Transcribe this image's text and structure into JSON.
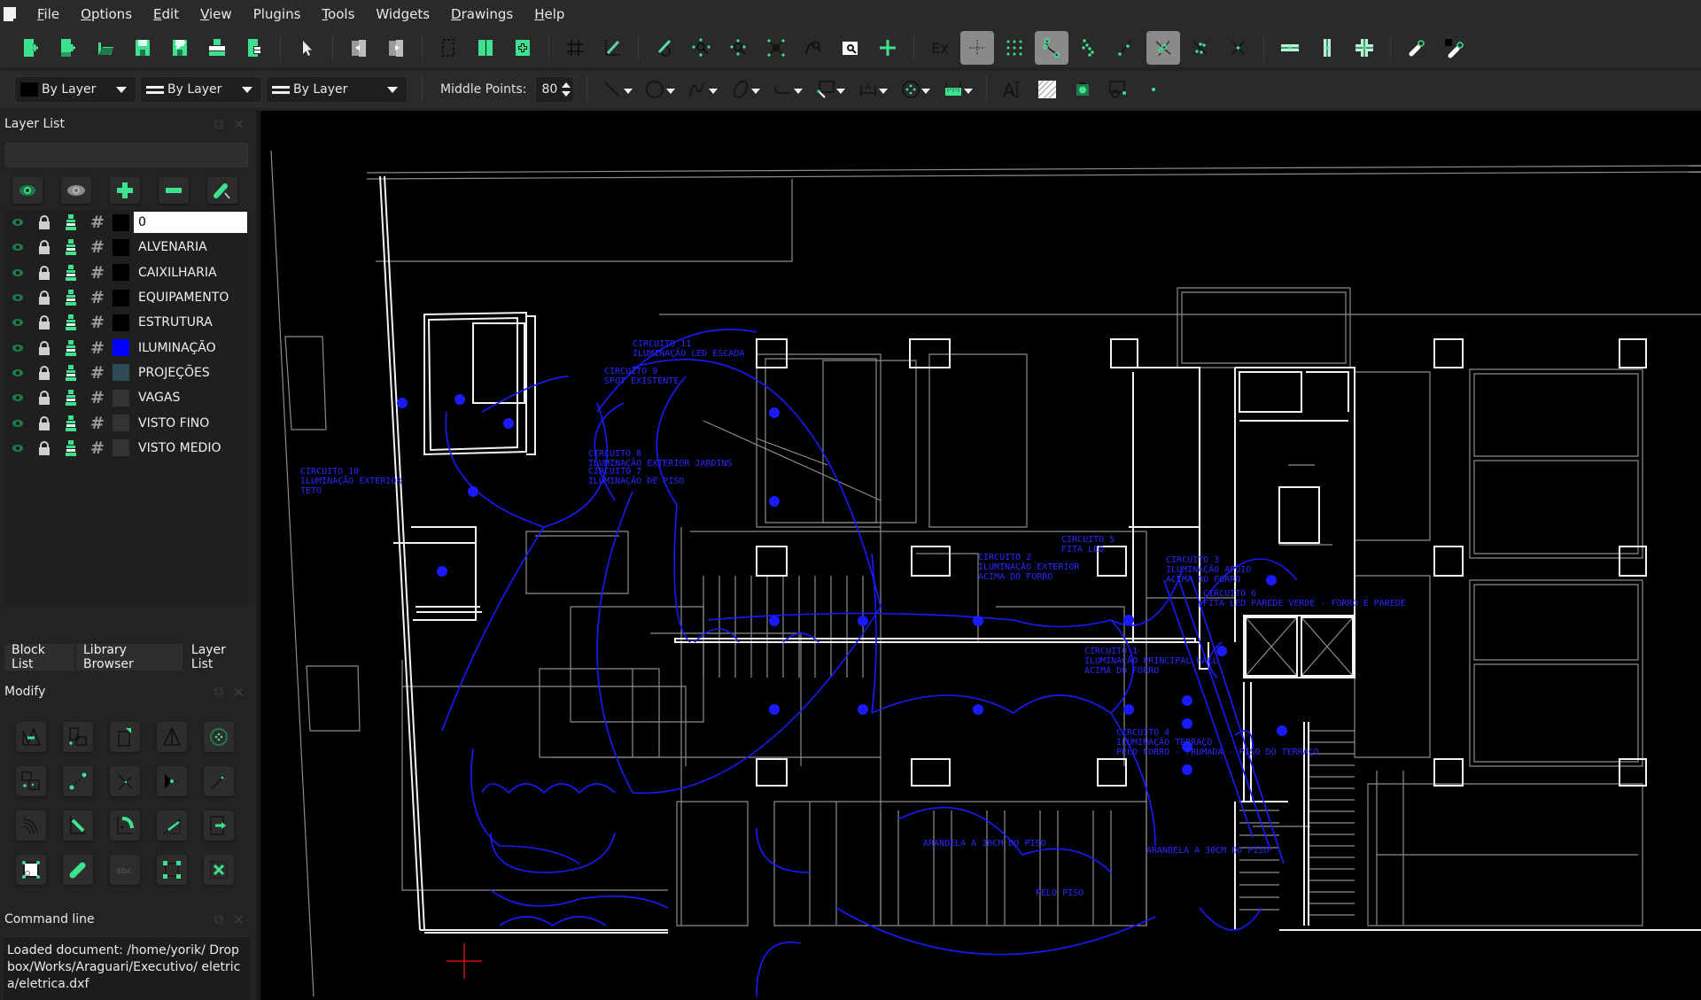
{
  "menubar": {
    "items": [
      {
        "label": "File",
        "ul": "F",
        "rest": "ile"
      },
      {
        "label": "Options",
        "ul": "O",
        "rest": "ptions"
      },
      {
        "label": "Edit",
        "ul": "E",
        "rest": "dit"
      },
      {
        "label": "View",
        "ul": "V",
        "rest": "iew"
      },
      {
        "label": "Plugins",
        "ul": "",
        "rest": "Plugins"
      },
      {
        "label": "Tools",
        "ul": "T",
        "rest": "ools"
      },
      {
        "label": "Widgets",
        "ul": "",
        "rest": "Widgets"
      },
      {
        "label": "Drawings",
        "ul": "D",
        "rest": "rawings"
      },
      {
        "label": "Help",
        "ul": "H",
        "rest": "elp"
      }
    ]
  },
  "toolbar1": {
    "file_tools": [
      "new-file",
      "new-from-template",
      "open-file",
      "save",
      "save-as",
      "print",
      "print-preview"
    ],
    "select_tool": "select-pointer",
    "block_tools": [
      "previous-view",
      "next-view",
      "window-select",
      "add-block",
      "insert-block"
    ],
    "snap_grid_label": "Ex",
    "snap_tools": [
      {
        "name": "snap-free",
        "active": true
      },
      {
        "name": "snap-grid",
        "active": false
      },
      {
        "name": "snap-endpoint",
        "active": true
      },
      {
        "name": "snap-on-entity",
        "active": false
      },
      {
        "name": "snap-center",
        "active": false
      },
      {
        "name": "snap-intersection",
        "active": true
      },
      {
        "name": "snap-middle",
        "active": false
      },
      {
        "name": "snap-distance",
        "active": false
      }
    ],
    "restrict_tools": [
      "restrict-horizontal",
      "restrict-vertical",
      "restrict-orthogonal"
    ],
    "relative_zero_tools": [
      "set-relative-zero",
      "lock-relative-zero"
    ]
  },
  "toolbar2": {
    "color_combo": "By Layer",
    "width_combo": "By Layer",
    "linetype_combo": "By Layer",
    "middle_points_label": "Middle Points:",
    "middle_points_value": "80",
    "draw_tools": [
      "line",
      "circle",
      "spline",
      "ellipse",
      "polyline",
      "select",
      "dimension",
      "modify",
      "info"
    ],
    "extra_tools": [
      "text",
      "hatch",
      "image",
      "block",
      "point"
    ]
  },
  "layer_panel": {
    "title": "Layer List",
    "filter_placeholder": "",
    "buttons": [
      "show-all-layers",
      "hide-all-layers",
      "add-layer",
      "remove-layer",
      "edit-layer"
    ],
    "layers": [
      {
        "name": "0",
        "color": "#000000",
        "editing": true
      },
      {
        "name": "ALVENARIA",
        "color": "#000000"
      },
      {
        "name": "CAIXILHARIA",
        "color": "#000000"
      },
      {
        "name": "EQUIPAMENTO",
        "color": "#000000"
      },
      {
        "name": "ESTRUTURA",
        "color": "#000000"
      },
      {
        "name": "ILUMINAÇÃO",
        "color": "#0000ff"
      },
      {
        "name": "PROJEÇÕES",
        "color": "#2f4a57"
      },
      {
        "name": "VAGAS",
        "color": "#333333"
      },
      {
        "name": "VISTO FINO",
        "color": "#333333"
      },
      {
        "name": "VISTO MEDIO",
        "color": "#333333"
      }
    ]
  },
  "dock_tabs": [
    {
      "label": "Block List",
      "active": false
    },
    {
      "label": "Library Browser",
      "active": false
    },
    {
      "label": "Layer List",
      "active": true
    }
  ],
  "modify_panel": {
    "title": "Modify",
    "tools": [
      "move",
      "copy",
      "scale",
      "mirror",
      "rotate",
      "rotate-two",
      "move-rotate",
      "trim",
      "trim-two",
      "lengthen",
      "offset",
      "bevel",
      "round",
      "stretch",
      "explode",
      "attributes",
      "properties",
      "explode-text",
      "delete-selection",
      "delete"
    ]
  },
  "command_line": {
    "title": "Command line",
    "output": "Loaded document: /home/yorik/ Dropbox/Works/Araguari/Executivo/ eletrica/eletrica.dxf"
  },
  "drawing": {
    "file": "eletrica.dxf",
    "annotations": [
      "CIRCUITO 11",
      "ILUMINAÇÃO LED ESCADA",
      "CIRCUITO 9",
      "SPOT EXISTENTE",
      "CIRCUITO 8",
      "ILUMINAÇÃO EXTERIOR JARDINS",
      "CIRCUITO 7",
      "ILUMINAÇÃO DE PISO",
      "CIRCUITO 10",
      "ILUMINAÇÃO EXTERIOR",
      "TETO",
      "CIRCUITO 2",
      "ILUMINAÇÃO EXTERIOR",
      "ACIMA DO FORRO",
      "CIRCUITO 5",
      "FITA LED",
      "CIRCUITO 3",
      "ILUMINAÇÃO APOIO",
      "ACIMA DO FORRO",
      "CIRCUITO 6",
      "FITA LED PAREDE VERDE - FORRO E PAREDE",
      "CIRCUITO 1",
      "ILUMINAÇÃO PRINCIPAL HALL",
      "ACIMA DO FORRO",
      "CIRCUITO 4",
      "ILUMINAÇÃO TERRAÇO",
      "PELO FORRO - PRUMADA - PISO DO TERRAÇO",
      "ARANDELA A 30CM DO PISO",
      "ARANDELA A 30CM DO PISO",
      "PELO PISO"
    ],
    "colors": {
      "walls": "#ffffff",
      "thin": "#9a9a9a",
      "lighting": "#1a1aff",
      "cursor": "#d01010"
    }
  }
}
